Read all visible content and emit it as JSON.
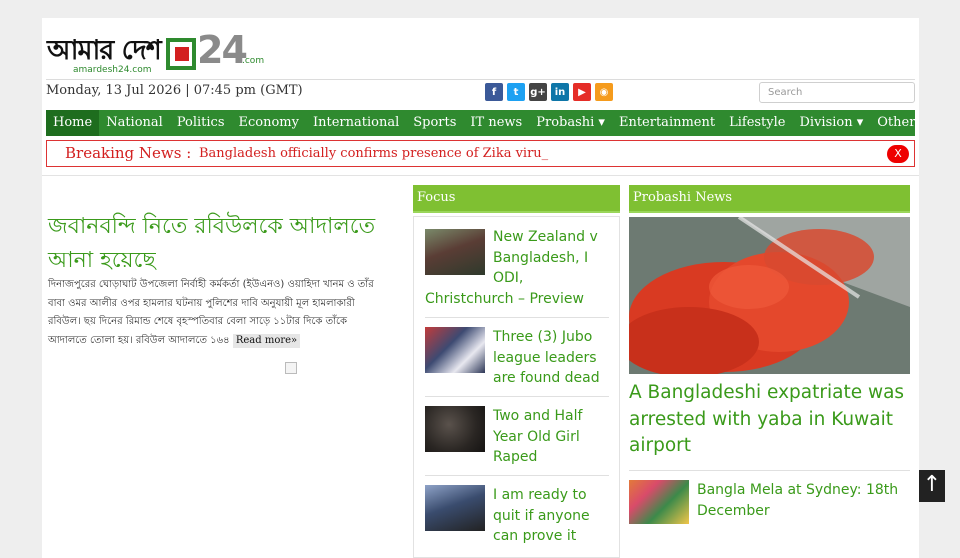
{
  "header": {
    "logo_bangla": "আমার দেশ",
    "logo_number": "24",
    "logo_com": ".com",
    "logo_sub": "amardesh24.com",
    "date": "Monday, 13 Jul 2026 | 07:45 pm (GMT)",
    "social": [
      {
        "icon": "facebook-icon",
        "glyph": "f",
        "color": "#3b5998"
      },
      {
        "icon": "twitter-icon",
        "glyph": "t",
        "color": "#1da1f2"
      },
      {
        "icon": "google-plus-icon",
        "glyph": "g+",
        "color": "#444444"
      },
      {
        "icon": "linkedin-icon",
        "glyph": "in",
        "color": "#0e76a8"
      },
      {
        "icon": "youtube-icon",
        "glyph": "▶",
        "color": "#e52d27"
      },
      {
        "icon": "rss-icon",
        "glyph": "◉",
        "color": "#f59b1c"
      }
    ],
    "search_placeholder": "Search"
  },
  "nav": {
    "items": [
      "Home",
      "National",
      "Politics",
      "Economy",
      "International",
      "Sports",
      "IT news",
      "Probashi ▾",
      "Entertainment",
      "Lifestyle",
      "Division ▾",
      "Other▾"
    ]
  },
  "breaking": {
    "label": "Breaking News :",
    "text": "Bangladesh officially confirms presence of Zika viru_",
    "close": "X"
  },
  "lead": {
    "headline": "জবানবন্দি নিতে রবিউলকে আদালতে আনা হয়েছে",
    "summary": "দিনাজপুরের ঘোড়াঘাট উপজেলা নির্বাহী কর্মকর্তা (ইউএনও) ওয়াহিদা খানম ও তাঁর বাবা ওমর আলীর ওপর হামলার ঘটনায় পুলিশের দাবি অনুযায়ী মূল হামলাকারী রবিউল। ছয় দিনের রিমান্ড শেষে বৃহস্পতিবার বেলা সাড়ে ১১টার দিকে তাঁকে আদালতে তোলা হয়। রবিউল আদালতে ১৬৪",
    "read_more": "Read more»"
  },
  "focus": {
    "heading": "Focus",
    "items": [
      {
        "title": "New Zealand v Bangladesh, I ODI, Christchurch – Preview",
        "thumb_color": "#5a3d35"
      },
      {
        "title": "Three (3) Jubo league leaders are found dead",
        "thumb_color": "#3d4a72"
      },
      {
        "title": "Two and Half Year Old Girl Raped",
        "thumb_color": "#2a2623"
      },
      {
        "title": "I am ready to quit if anyone can prove it",
        "thumb_color": "#3a4c6e"
      }
    ]
  },
  "probashi": {
    "heading": "Probashi News",
    "main_title": "A Bangladeshi expatriate was arrested with yaba in Kuwait airport",
    "item_title": "Bangla Mela at Sydney: 18th December"
  },
  "scroll_top": "↑"
}
